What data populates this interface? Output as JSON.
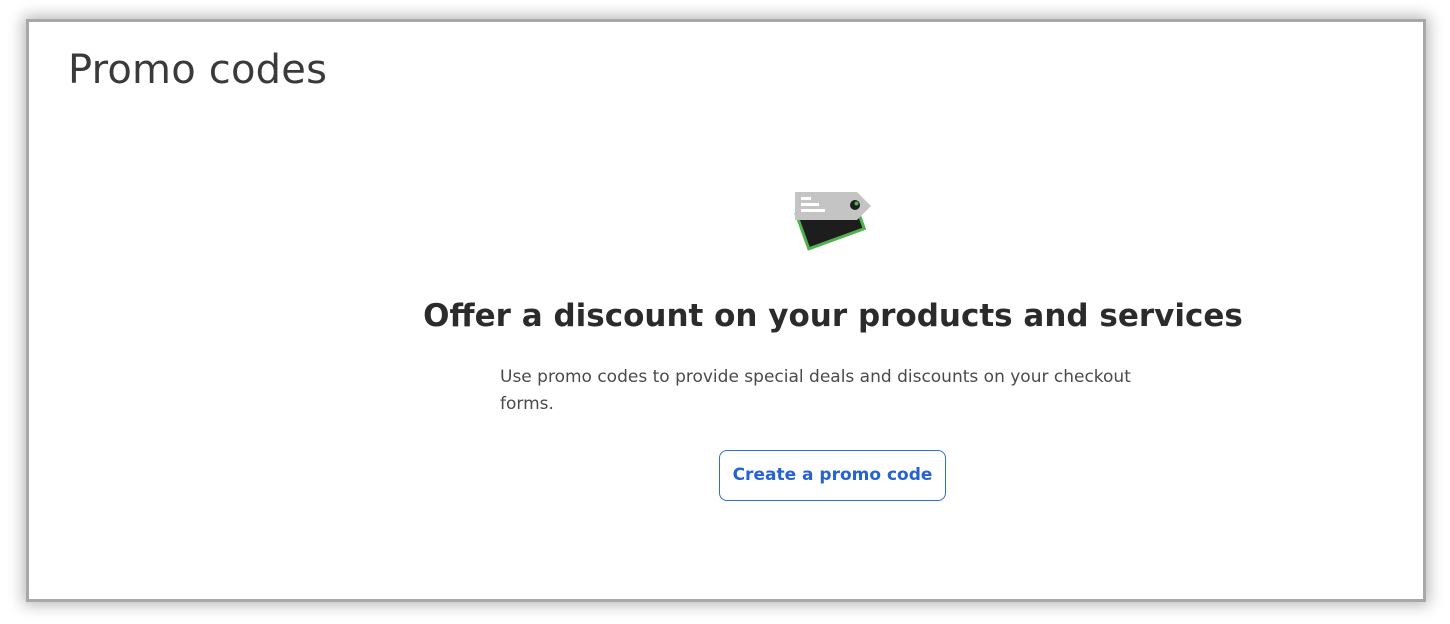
{
  "page": {
    "title": "Promo codes"
  },
  "empty_state": {
    "icon": "promo-tags-icon",
    "headline": "Offer a discount on your products and services",
    "description": "Use promo codes to provide special deals and discounts on your checkout forms.",
    "button_label": "Create a promo code"
  },
  "colors": {
    "accent": "#2563cf",
    "title_text": "#3a3a3a",
    "body_text": "#4a4a4a",
    "tag_green": "#4fb24f",
    "tag_gray": "#c4c4c4"
  }
}
